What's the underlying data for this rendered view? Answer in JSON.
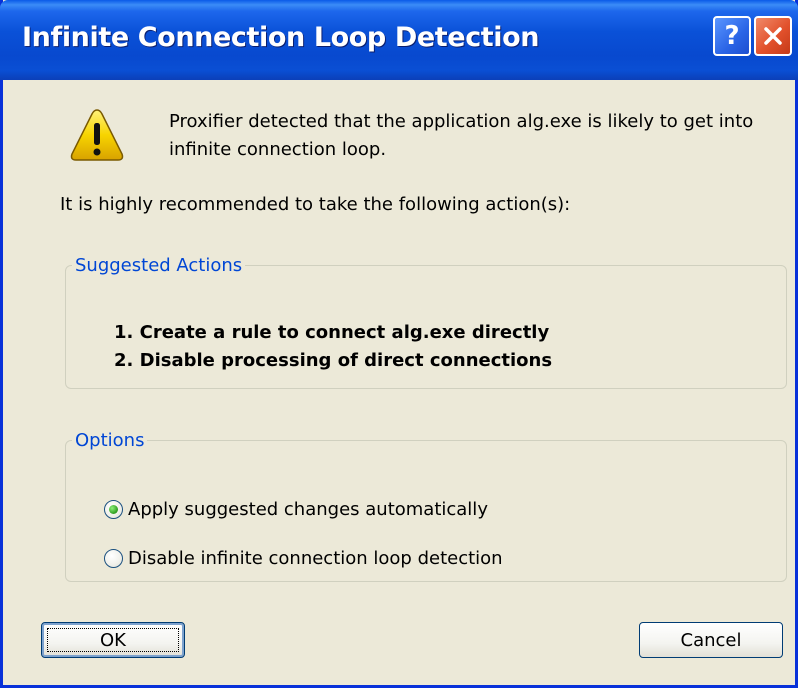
{
  "window": {
    "title": "Infinite Connection Loop Detection",
    "help_label": "?",
    "close_label": "close"
  },
  "icon": {
    "name": "warning-icon",
    "color": "#f5d200"
  },
  "message": {
    "text": "Proxifier detected that the application alg.exe is likely to get into infinite connection loop."
  },
  "recommendation": "It is highly recommended to take the following action(s):",
  "suggested_actions": {
    "legend": "Suggested Actions",
    "items": [
      "1. Create a rule to connect alg.exe directly",
      "2. Disable processing of direct connections"
    ]
  },
  "options": {
    "legend": "Options",
    "radios": [
      {
        "label": "Apply suggested changes automatically",
        "checked": true
      },
      {
        "label": "Disable infinite connection loop detection",
        "checked": false
      }
    ]
  },
  "buttons": {
    "ok": "OK",
    "cancel": "Cancel"
  },
  "colors": {
    "titlebar": "#0a51d8",
    "group_legend": "#0046d5",
    "dialog_bg": "#ece9d8"
  }
}
